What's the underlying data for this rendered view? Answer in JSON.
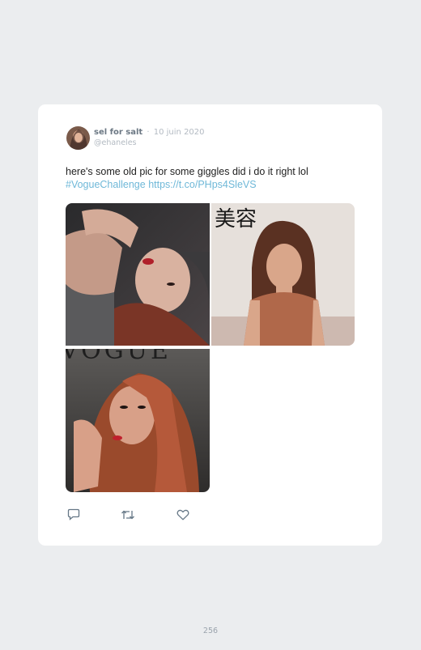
{
  "tweet": {
    "display_name": "sel for salt",
    "separator": "·",
    "date": "10 juin 2020",
    "handle": "@ehaneles",
    "text": "here's some old pic for some giggles did i do it right lol",
    "hashtag": "#VogueChallenge",
    "link": "https://t.co/PHps4SleVS",
    "photos": [
      {
        "description_icon": "photo-icon"
      },
      {
        "description_icon": "photo-icon"
      },
      {
        "description_icon": "photo-icon"
      }
    ],
    "actions": [
      {
        "icon": "reply-icon"
      },
      {
        "icon": "retweet-icon"
      },
      {
        "icon": "like-icon"
      }
    ]
  },
  "page": {
    "number": "256"
  },
  "colors": {
    "background": "#ebedef",
    "card": "#ffffff",
    "link": "#6fb8d8",
    "name": "#6c7884",
    "muted": "#b3bac2"
  }
}
